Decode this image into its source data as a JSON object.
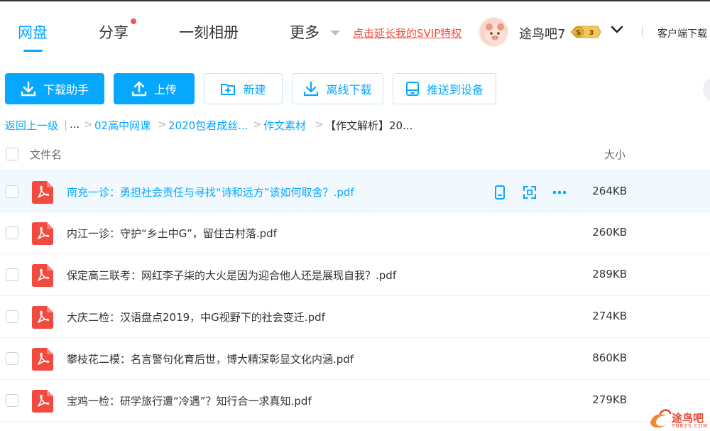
{
  "nav": {
    "items": [
      {
        "label": "网盘"
      },
      {
        "label": "分享"
      },
      {
        "label": "一刻相册"
      },
      {
        "label": "更多"
      }
    ],
    "svip_link": "点击延长我的SVIP特权",
    "username": "途鸟吧7",
    "vip_badge_letter": "S",
    "vip_level": "3",
    "client_download": "客户端下载"
  },
  "toolbar": {
    "download_helper": "下载助手",
    "upload": "上传",
    "new": "新建",
    "offline_download": "离线下载",
    "push_to_device": "推送到设备"
  },
  "breadcrumb": {
    "back": "返回上一级",
    "sep_bar": "|",
    "ellipsis": "...",
    "sep": ">",
    "items": [
      "02高中网课",
      "2020包君成丝...",
      "作文素材"
    ],
    "current": "【作文解析】20..."
  },
  "list": {
    "header_name": "文件名",
    "header_size": "大小",
    "rows": [
      {
        "name": "南充一诊：勇担社会责任与寻找“诗和远方”该如何取舍？.pdf",
        "size": "264KB"
      },
      {
        "name": "内江一诊：守护“乡土中G”，留住古村落.pdf",
        "size": "260KB"
      },
      {
        "name": "保定高三联考：网红李子柒的大火是因为迎合他人还是展现自我？.pdf",
        "size": "289KB"
      },
      {
        "name": "大庆二检：汉语盘点2019，中G视野下的社会变迁.pdf",
        "size": "274KB"
      },
      {
        "name": "攀枝花二模：名言警句化育后世，博大精深彰显文化内涵.pdf",
        "size": "860KB"
      },
      {
        "name": "宝鸡一检：研学旅行遭“冷遇”？知行合一求真知.pdf",
        "size": "279KB"
      }
    ]
  },
  "watermark": {
    "text": "途鸟吧",
    "sub": "TNBZS.COM"
  },
  "colors": {
    "accent": "#06a7ff",
    "svip_red": "#f14d3d",
    "pdf_red": "#f34a40",
    "hover_row": "#f1f9ff"
  }
}
